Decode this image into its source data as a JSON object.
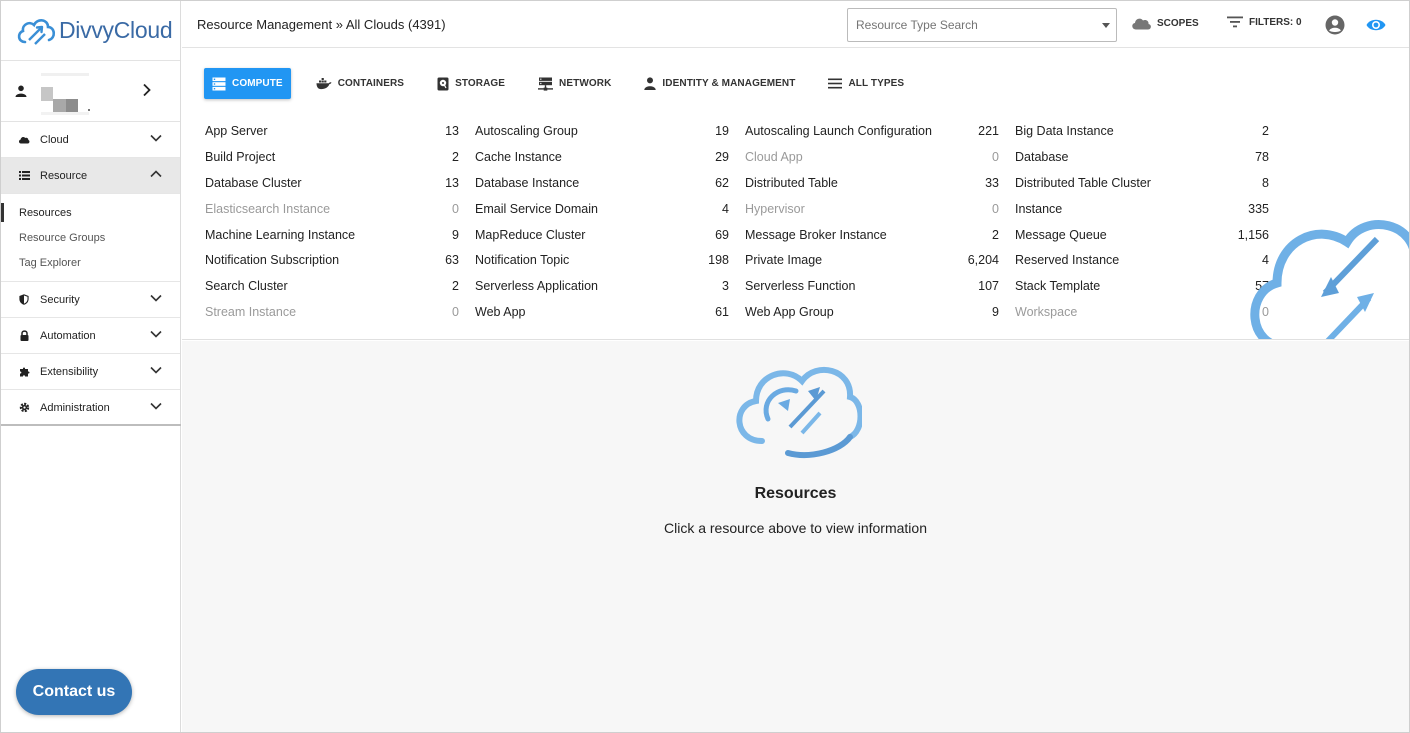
{
  "app": {
    "logo_text": "DivvyCloud",
    "brand_color": "#3a6aa5"
  },
  "sidebar": {
    "nav": [
      {
        "label": "Cloud",
        "icon": "cloud-icon"
      },
      {
        "label": "Resource",
        "icon": "list-icon"
      },
      {
        "label": "Security",
        "icon": "shield-icon"
      },
      {
        "label": "Automation",
        "icon": "lock-icon"
      },
      {
        "label": "Extensibility",
        "icon": "puzzle-icon"
      },
      {
        "label": "Administration",
        "icon": "gear-icon"
      }
    ],
    "resource_sub": [
      {
        "label": "Resources"
      },
      {
        "label": "Resource Groups"
      },
      {
        "label": "Tag Explorer"
      }
    ],
    "contact_label": "Contact us"
  },
  "header": {
    "breadcrumb": "Resource Management » All Clouds (4391)",
    "search_placeholder": "Resource Type Search",
    "scopes_label": "SCOPES",
    "filters_label": "FILTERS: 0"
  },
  "tabs": [
    {
      "label": "COMPUTE",
      "icon": "server-icon",
      "active": true
    },
    {
      "label": "CONTAINERS",
      "icon": "docker-icon"
    },
    {
      "label": "STORAGE",
      "icon": "disk-icon"
    },
    {
      "label": "NETWORK",
      "icon": "network-icon"
    },
    {
      "label": "IDENTITY & MANAGEMENT",
      "icon": "person-icon"
    },
    {
      "label": "ALL TYPES",
      "icon": "menu-icon"
    }
  ],
  "resources": {
    "col1": [
      {
        "name": "App Server",
        "count": "13"
      },
      {
        "name": "Build Project",
        "count": "2"
      },
      {
        "name": "Database Cluster",
        "count": "13"
      },
      {
        "name": "Elasticsearch Instance",
        "count": "0"
      },
      {
        "name": "Machine Learning Instance",
        "count": "9"
      },
      {
        "name": "Notification Subscription",
        "count": "63"
      },
      {
        "name": "Search Cluster",
        "count": "2"
      },
      {
        "name": "Stream Instance",
        "count": "0"
      }
    ],
    "col2": [
      {
        "name": "Autoscaling Group",
        "count": "19"
      },
      {
        "name": "Cache Instance",
        "count": "29"
      },
      {
        "name": "Database Instance",
        "count": "62"
      },
      {
        "name": "Email Service Domain",
        "count": "4"
      },
      {
        "name": "MapReduce Cluster",
        "count": "69"
      },
      {
        "name": "Notification Topic",
        "count": "198"
      },
      {
        "name": "Serverless Application",
        "count": "3"
      },
      {
        "name": "Web App",
        "count": "61"
      }
    ],
    "col3": [
      {
        "name": "Autoscaling Launch Configuration",
        "count": "221"
      },
      {
        "name": "Cloud App",
        "count": "0"
      },
      {
        "name": "Distributed Table",
        "count": "33"
      },
      {
        "name": "Hypervisor",
        "count": "0"
      },
      {
        "name": "Message Broker Instance",
        "count": "2"
      },
      {
        "name": "Private Image",
        "count": "6,204"
      },
      {
        "name": "Serverless Function",
        "count": "107"
      },
      {
        "name": "Web App Group",
        "count": "9"
      }
    ],
    "col4": [
      {
        "name": "Big Data Instance",
        "count": "2"
      },
      {
        "name": "Database",
        "count": "78"
      },
      {
        "name": "Distributed Table Cluster",
        "count": "8"
      },
      {
        "name": "Instance",
        "count": "335"
      },
      {
        "name": "Message Queue",
        "count": "1,156"
      },
      {
        "name": "Reserved Instance",
        "count": "4"
      },
      {
        "name": "Stack Template",
        "count": "57"
      },
      {
        "name": "Workspace",
        "count": "0"
      }
    ]
  },
  "empty_state": {
    "title": "Resources",
    "subtitle": "Click a resource above to view information"
  },
  "colors": {
    "accent": "#2196f3",
    "cloud_light": "#6fb0e6",
    "cloud_dark": "#4a90d0",
    "contact": "#3375b5"
  }
}
